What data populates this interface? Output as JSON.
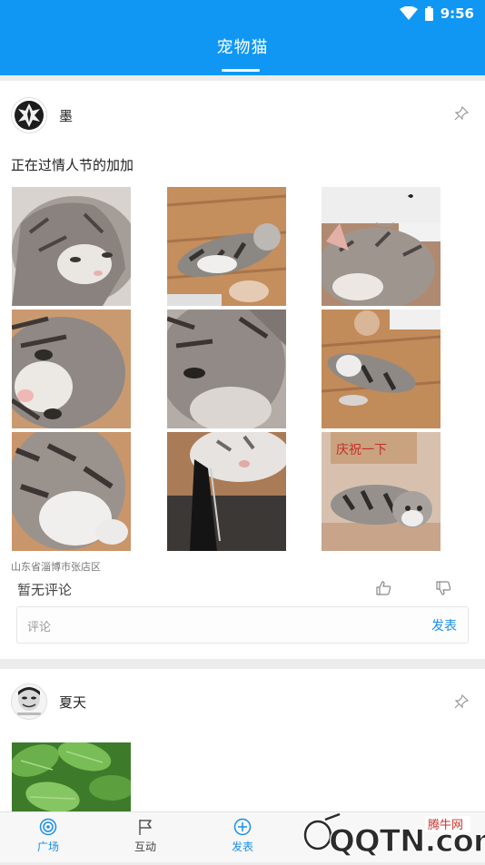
{
  "status_bar": {
    "time": "9:56"
  },
  "app_bar": {
    "title": "宠物猫"
  },
  "posts": [
    {
      "username": "墨",
      "text": "正在过情人节的加加",
      "location": "山东省淄博市张店区",
      "comment_status": "暂无评论",
      "comment_placeholder": "评论",
      "publish_label": "发表",
      "photo_count": 9
    },
    {
      "username": "夏天"
    }
  ],
  "bottom_nav": {
    "items": [
      {
        "label": "广场",
        "icon": "radar-icon",
        "active": true
      },
      {
        "label": "互动",
        "icon": "flag-icon",
        "active": false
      },
      {
        "label": "发表",
        "icon": "plus-circle-icon",
        "active": false
      }
    ]
  },
  "watermark": {
    "text": "腾牛网",
    "site": "QQTN.com"
  },
  "colors": {
    "accent": "#0f97f3",
    "link": "#1a8fe6",
    "background": "#ececec"
  }
}
